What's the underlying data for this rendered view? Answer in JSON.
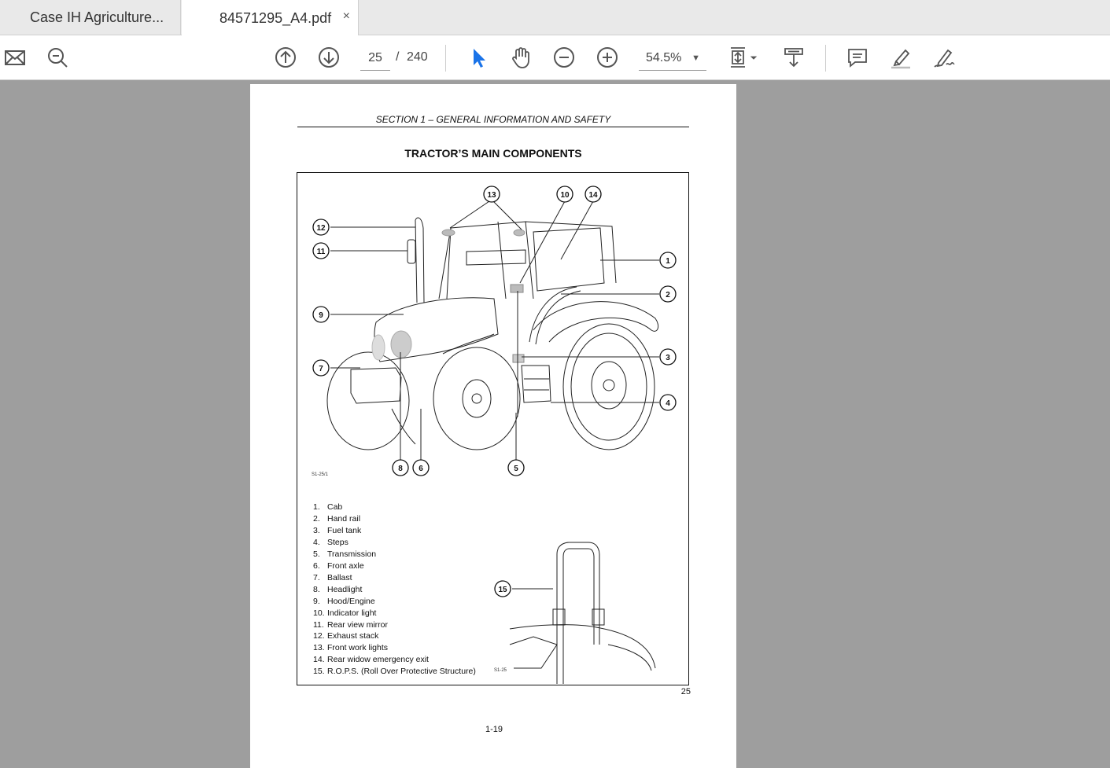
{
  "tabs": [
    {
      "label": "Case IH Agriculture..."
    },
    {
      "label": "84571295_A4.pdf",
      "close": "×"
    }
  ],
  "toolbar": {
    "current_page": "25",
    "page_sep": "/",
    "total_pages": "240",
    "zoom": "54.5%",
    "zoom_caret": "▼",
    "icons": [
      "mail-icon",
      "search-icon",
      "page-up-icon",
      "page-down-icon",
      "select-cursor-icon",
      "hand-tool-icon",
      "zoom-out-icon",
      "zoom-in-icon",
      "fit-page-icon",
      "scroll-mode-icon",
      "comment-icon",
      "highlight-icon",
      "sign-icon"
    ]
  },
  "document": {
    "section_header": "SECTION 1 – GENERAL INFORMATION AND SAFETY",
    "title": "TRACTOR’S MAIN COMPONENTS",
    "figure_code_1": "S1-25/1",
    "figure_code_2": "S1-25",
    "callouts": [
      "13",
      "10",
      "14",
      "12",
      "11",
      "1",
      "2",
      "9",
      "3",
      "7",
      "4",
      "8",
      "6",
      "5",
      "15"
    ],
    "legend": [
      {
        "num": "1.",
        "text": "Cab"
      },
      {
        "num": "2.",
        "text": "Hand rail"
      },
      {
        "num": "3.",
        "text": "Fuel tank"
      },
      {
        "num": "4.",
        "text": "Steps"
      },
      {
        "num": "5.",
        "text": "Transmission"
      },
      {
        "num": "6.",
        "text": "Front axle"
      },
      {
        "num": "7.",
        "text": "Ballast"
      },
      {
        "num": "8.",
        "text": "Headlight"
      },
      {
        "num": "9.",
        "text": "Hood/Engine"
      },
      {
        "num": "10.",
        "text": "Indicator light"
      },
      {
        "num": "11.",
        "text": "Rear view mirror"
      },
      {
        "num": "12.",
        "text": "Exhaust stack"
      },
      {
        "num": "13.",
        "text": "Front work lights"
      },
      {
        "num": "14.",
        "text": "Rear widow emergency exit"
      },
      {
        "num": "15.",
        "text": "R.O.P.S. (Roll Over Protective Structure)"
      }
    ],
    "page_number_corner": "25",
    "page_number_bottom": "1-19"
  }
}
